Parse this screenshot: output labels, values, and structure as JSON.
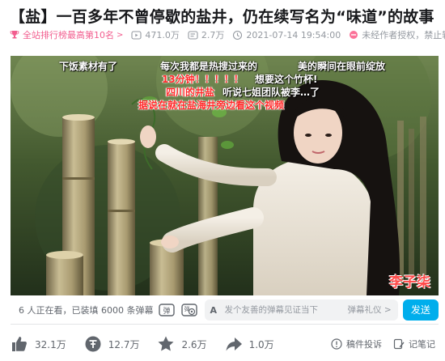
{
  "title": "【盐】一百多年不曾停歇的盐井，仍在续写名为“味道”的故事",
  "meta": {
    "rank": "全站排行榜最高第10名",
    "rank_chevron": ">",
    "views": "471.0万",
    "danmaku_count": "2.7万",
    "pubdate": "2021-07-14 19:54:00",
    "copyright": "未经作者授权，禁止转载"
  },
  "player": {
    "danmaku": [
      {
        "text": "下饭素材有了",
        "color": "white"
      },
      {
        "text": "每次我都是热搜过来的",
        "color": "white"
      },
      {
        "text": "美的瞬间在眼前绽放",
        "color": "white"
      },
      {
        "text": "13分钟！！！！！",
        "color": "red"
      },
      {
        "text": "想要这个竹杯!",
        "color": "white"
      },
      {
        "text": "四川的井盐",
        "color": "red"
      },
      {
        "text": "听说七姐团队被李…了",
        "color": "white"
      },
      {
        "text": "据说在就在盐海井旁边看这个视频",
        "color": "red"
      }
    ],
    "watermark": "李子柒"
  },
  "danmaku_bar": {
    "online_text": "6 人正在看，已装填 6000 条弹幕",
    "input_placeholder": "发个友善的弹幕见证当下",
    "etiquette": "弹幕礼仪 >",
    "send_label": "发送",
    "dm_toggle_icon": "danmaku-toggle-icon",
    "dm_settings_icon": "danmaku-settings-icon"
  },
  "toolbar": {
    "like": "32.1万",
    "coin": "12.7万",
    "favorite": "2.6万",
    "share": "1.0万",
    "report": "稿件投诉",
    "notes": "记笔记"
  },
  "colors": {
    "accent": "#00aeec",
    "rank_pink": "#f25d8e",
    "muted": "#9499a0"
  }
}
